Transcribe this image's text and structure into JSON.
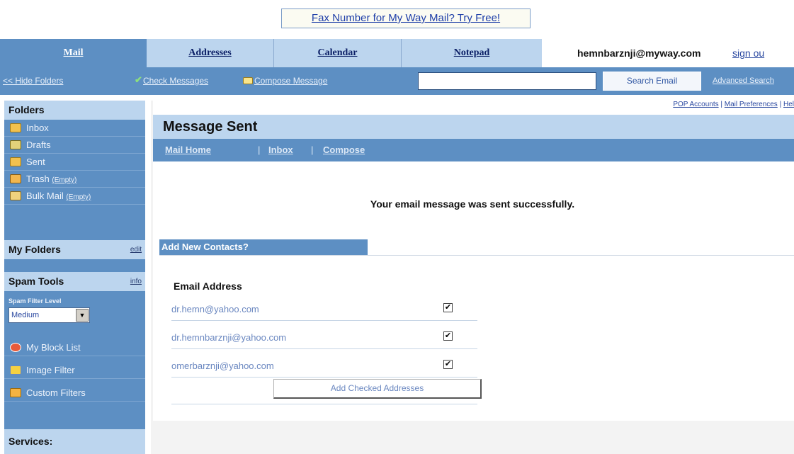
{
  "ad": {
    "text": "Fax Number for My Way Mail? Try Free!"
  },
  "tabs": [
    {
      "label": "Mail"
    },
    {
      "label": "Addresses"
    },
    {
      "label": "Calendar"
    },
    {
      "label": "Notepad"
    }
  ],
  "user": {
    "email": "hemnbarznji@myway.com",
    "sign_out": "sign ou"
  },
  "actions": {
    "hide_folders": "<< Hide Folders",
    "check_messages": "Check Messages",
    "compose_message": "Compose Message",
    "search_value": "",
    "search_button": "Search Email",
    "advanced_search": "Advanced Search"
  },
  "sidebar": {
    "folders_heading": "Folders",
    "folders": [
      {
        "label": "Inbox",
        "icon": "inbox-folder-icon"
      },
      {
        "label": "Drafts",
        "icon": "drafts-folder-icon"
      },
      {
        "label": "Sent",
        "icon": "sent-folder-icon"
      },
      {
        "label": "Trash",
        "extra": "(Empty)",
        "icon": "trash-folder-icon"
      },
      {
        "label": "Bulk Mail",
        "extra": "(Empty)",
        "icon": "bulk-folder-icon"
      }
    ],
    "my_folders": {
      "label": "My Folders",
      "action": "edit"
    },
    "spam_tools": {
      "label": "Spam Tools",
      "action": "info"
    },
    "spam_filter_label": "Spam Filter Level",
    "spam_filter_value": "Medium",
    "tools": [
      {
        "label": "My Block List",
        "icon": "block-list-icon"
      },
      {
        "label": "Image Filter",
        "icon": "image-filter-icon"
      },
      {
        "label": "Custom Filters",
        "icon": "custom-filters-icon"
      }
    ],
    "services_heading": "Services:"
  },
  "main": {
    "top_links": [
      "POP Accounts",
      "Mail Preferences",
      "Hel"
    ],
    "title": "Message Sent",
    "sub_nav": [
      "Mail Home",
      "Inbox",
      "Compose"
    ],
    "success_message": "Your email message was sent successfully.",
    "contacts_heading": "Add New Contacts?",
    "email_column": "Email Address",
    "contacts": [
      {
        "address": "dr.hemn@yahoo.com",
        "checked": true
      },
      {
        "address": "dr.hemnbarznji@yahoo.com",
        "checked": true
      },
      {
        "address": "omerbarznji@yahoo.com",
        "checked": true
      }
    ],
    "add_button": "Add Checked Addresses"
  },
  "colors": {
    "nav_blue": "#5d8fc3",
    "light_blue": "#bcd5ee",
    "link_blue": "#2a48a0"
  }
}
